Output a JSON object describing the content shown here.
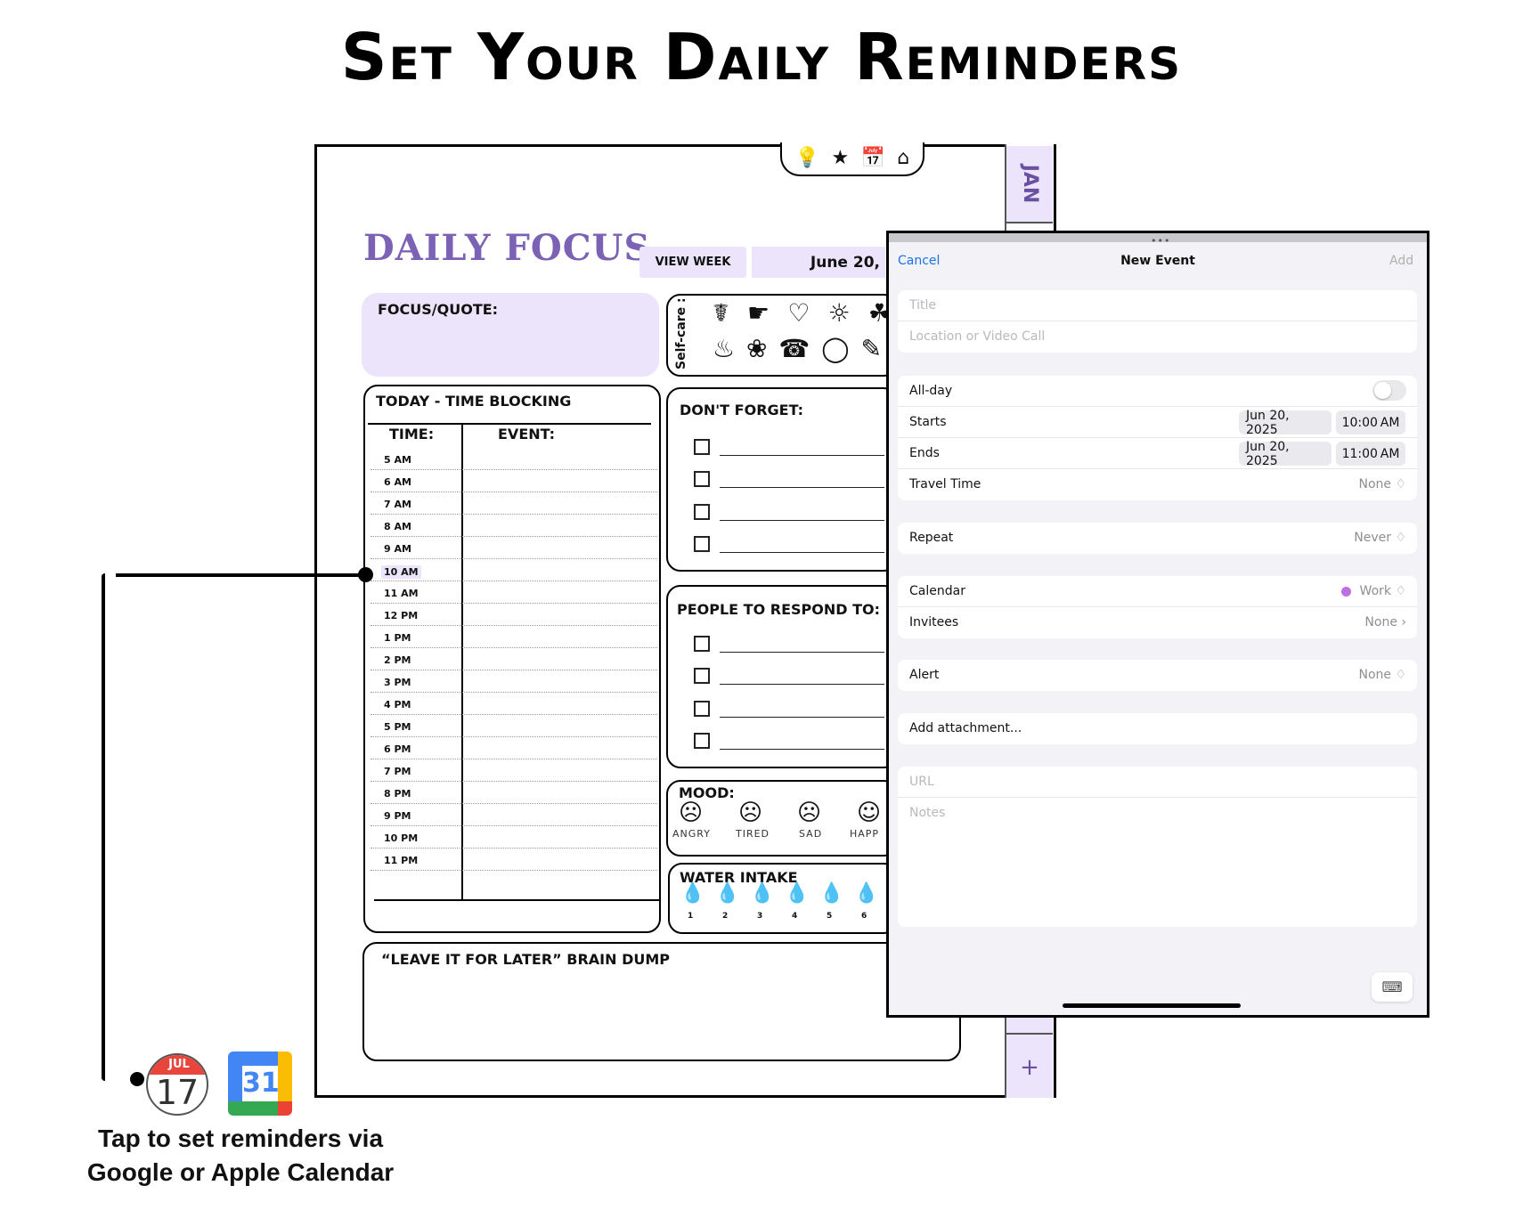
{
  "headline": "Set Your Daily Reminders",
  "planner": {
    "tab_month": "JAN",
    "tab_plus": "+",
    "nav_icons": [
      "lightbulb-icon",
      "star-icon",
      "calendar-icon",
      "home-icon"
    ],
    "title": "DAILY FOCUS",
    "view_week": "VIEW WEEK",
    "date": "June 20,",
    "focus_label": "FOCUS/QUOTE:",
    "selfcare_label": "Self-care :",
    "time_blocking": {
      "label": "TODAY - TIME BLOCKING",
      "time_header": "TIME:",
      "event_header": "EVENT:",
      "slots": [
        "5 AM",
        "6 AM",
        "7 AM",
        "8 AM",
        "9 AM",
        "10 AM",
        "11 AM",
        "12 PM",
        "1 PM",
        "2 PM",
        "3 PM",
        "4 PM",
        "5 PM",
        "6 PM",
        "7 PM",
        "8 PM",
        "9 PM",
        "10 PM",
        "11 PM"
      ],
      "highlighted": "10 AM"
    },
    "dont_forget": "DON'T FORGET:",
    "people": "PEOPLE TO RESPOND TO:",
    "mood": {
      "label": "MOOD:",
      "items": [
        "ANGRY",
        "TIRED",
        "SAD",
        "HAPP"
      ]
    },
    "water": {
      "label": "WATER INTAKE",
      "numbers": [
        "1",
        "2",
        "3",
        "4",
        "5",
        "6"
      ]
    },
    "brain_dump": "“LEAVE IT FOR LATER” BRAIN DUMP"
  },
  "event_sheet": {
    "grabber": "•••",
    "cancel": "Cancel",
    "title": "New Event",
    "add": "Add",
    "title_placeholder": "Title",
    "location_placeholder": "Location or Video Call",
    "all_day": "All-day",
    "starts_label": "Starts",
    "starts_date": "Jun 20, 2025",
    "starts_time": "10:00 AM",
    "ends_label": "Ends",
    "ends_date": "Jun 20, 2025",
    "ends_time": "11:00 AM",
    "travel_label": "Travel Time",
    "travel_value": "None ♢",
    "repeat_label": "Repeat",
    "repeat_value": "Never ♢",
    "calendar_label": "Calendar",
    "calendar_value": "Work ♢",
    "calendar_color": "#bf6fe0",
    "invitees_label": "Invitees",
    "invitees_value": "None ›",
    "alert_label": "Alert",
    "alert_value": "None ♢",
    "attachment": "Add attachment...",
    "url_placeholder": "URL",
    "notes_placeholder": "Notes",
    "accent": "#1a73e8"
  },
  "calendars": {
    "apple_month": "JUL",
    "apple_day": "17",
    "google_day": "31"
  },
  "caption_line1": "Tap to set reminders via",
  "caption_line2": "Google or Apple Calendar",
  "colors": {
    "lavender": "#ece4fa",
    "purple": "#7c62b5"
  }
}
